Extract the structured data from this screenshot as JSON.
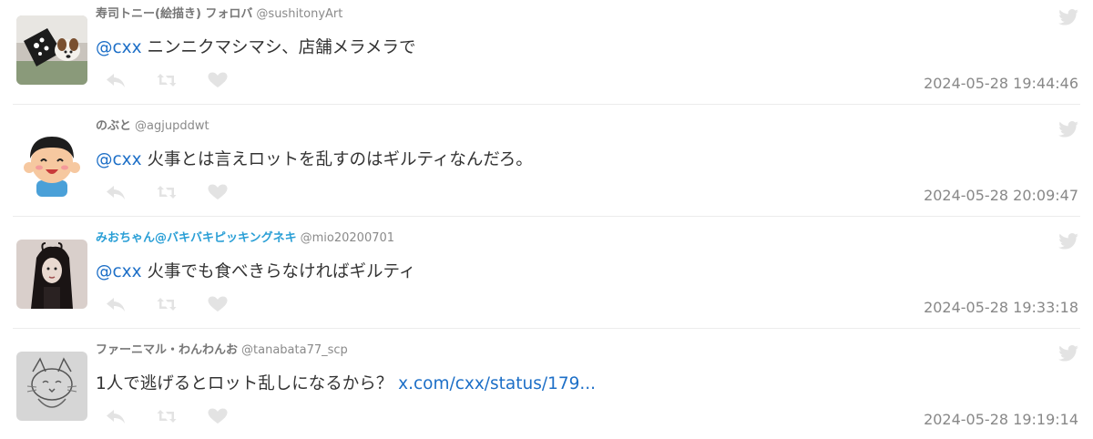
{
  "tweets": [
    {
      "name": "寿司トニー(絵描き) フォロバ",
      "handle": "@sushitonyArt",
      "mention": "@cxx",
      "text": " ニンニクマシマシ、店舗メラメラで",
      "link": "",
      "time": "2024-05-28 19:44:46",
      "avatar_icon": "dog-in-bag-avatar"
    },
    {
      "name": "のぶと",
      "handle": "@agjupddwt",
      "mention": "@cxx",
      "text": " 火事とは言えロットを乱すのはギルティなんだろ。",
      "link": "",
      "time": "2024-05-28 20:09:47",
      "avatar_icon": "cartoon-boy-avatar"
    },
    {
      "name": "みおちゃん@バキバキピッキングネキ",
      "handle": "@mio20200701",
      "mention": "@cxx",
      "text": " 火事でも食べきらなければギルティ",
      "link": "",
      "time": "2024-05-28 19:33:18",
      "avatar_icon": "girl-photo-avatar"
    },
    {
      "name": "ファーニマル・わんわんお",
      "handle": "@tanabata77_scp",
      "mention": "",
      "text": "1人で逃げるとロット乱しになるから？ ",
      "link": "x.com/cxx/status/179...",
      "time": "2024-05-28 19:19:14",
      "avatar_icon": "cat-sketch-avatar"
    }
  ],
  "colors": {
    "mention": "#1d6fc7",
    "name": "#777777",
    "name_highlight": "#2a9fd6",
    "icon": "#e3e3e3",
    "time": "#888888"
  },
  "icons": {
    "reply": "reply-icon",
    "retweet": "retweet-icon",
    "like": "heart-icon",
    "brand": "twitter-bird-icon"
  }
}
